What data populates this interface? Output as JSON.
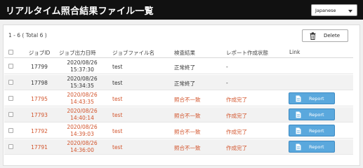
{
  "header": {
    "title": "リアルタイム照合結果ファイル一覧",
    "language": "Japanese"
  },
  "toolbar": {
    "count_text": "1 - 6 ( Total 6 )",
    "delete_label": "Delete"
  },
  "table": {
    "columns": [
      "ジョブID",
      "ジョブ出力日時",
      "ジョブファイル名",
      "検査結果",
      "レポート作成状態",
      "Link"
    ],
    "rows": [
      {
        "id": "17799",
        "date": "2020/08/26",
        "time": "15:37:30",
        "file": "test",
        "result": "正常終了",
        "report_status": "-",
        "link": ""
      },
      {
        "id": "17798",
        "date": "2020/08/26",
        "time": "15:34:35",
        "file": "test",
        "result": "正常終了",
        "report_status": "-",
        "link": ""
      },
      {
        "id": "17795",
        "date": "2020/08/26",
        "time": "14:43:35",
        "file": "test",
        "result": "照合不一致",
        "report_status": "作成完了",
        "link": "Report"
      },
      {
        "id": "17793",
        "date": "2020/08/26",
        "time": "14:40:14",
        "file": "test",
        "result": "照合不一致",
        "report_status": "作成完了",
        "link": "Report"
      },
      {
        "id": "17792",
        "date": "2020/08/26",
        "time": "14:39:03",
        "file": "test",
        "result": "照合不一致",
        "report_status": "作成完了",
        "link": "Report"
      },
      {
        "id": "17791",
        "date": "2020/08/26",
        "time": "14:36:00",
        "file": "test",
        "result": "照合不一致",
        "report_status": "作成完了",
        "link": "Report"
      }
    ]
  },
  "colors": {
    "header_bg": "#111111",
    "error_text": "#d2542c",
    "report_button": "#5aa8dd"
  },
  "icons": {
    "delete": "trash-icon",
    "report": "document-icon",
    "language": "chevron-down-icon"
  }
}
